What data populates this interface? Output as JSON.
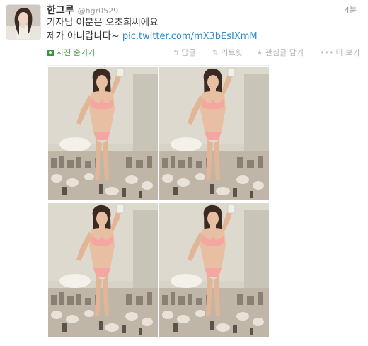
{
  "tweet": {
    "fullname": "한그루",
    "username": "@hgr0529",
    "timestamp": "4분",
    "text_line1": "기자님 이분은 오초희씨에요",
    "text_line2": "제가 아니랍니다~ ",
    "link": "pic.twitter.com/mX3bEsIXmM",
    "avatar_icon": "profile-photo",
    "photo_panels": 4
  },
  "actions": {
    "hide_photo": "사진 숨기기",
    "reply": "답글",
    "retweet": "리트윗",
    "favorite": "관심글 담기",
    "more": "더 보기",
    "photo_icon": "photo-icon",
    "reply_icon": "reply-icon",
    "retweet_icon": "retweet-icon",
    "favorite_icon": "star-icon",
    "more_icon": "more-dots-icon"
  },
  "colors": {
    "link": "#2a8bd0",
    "hide_photo": "#3a9a3a",
    "muted": "#999999",
    "action": "#b4b4b4"
  }
}
